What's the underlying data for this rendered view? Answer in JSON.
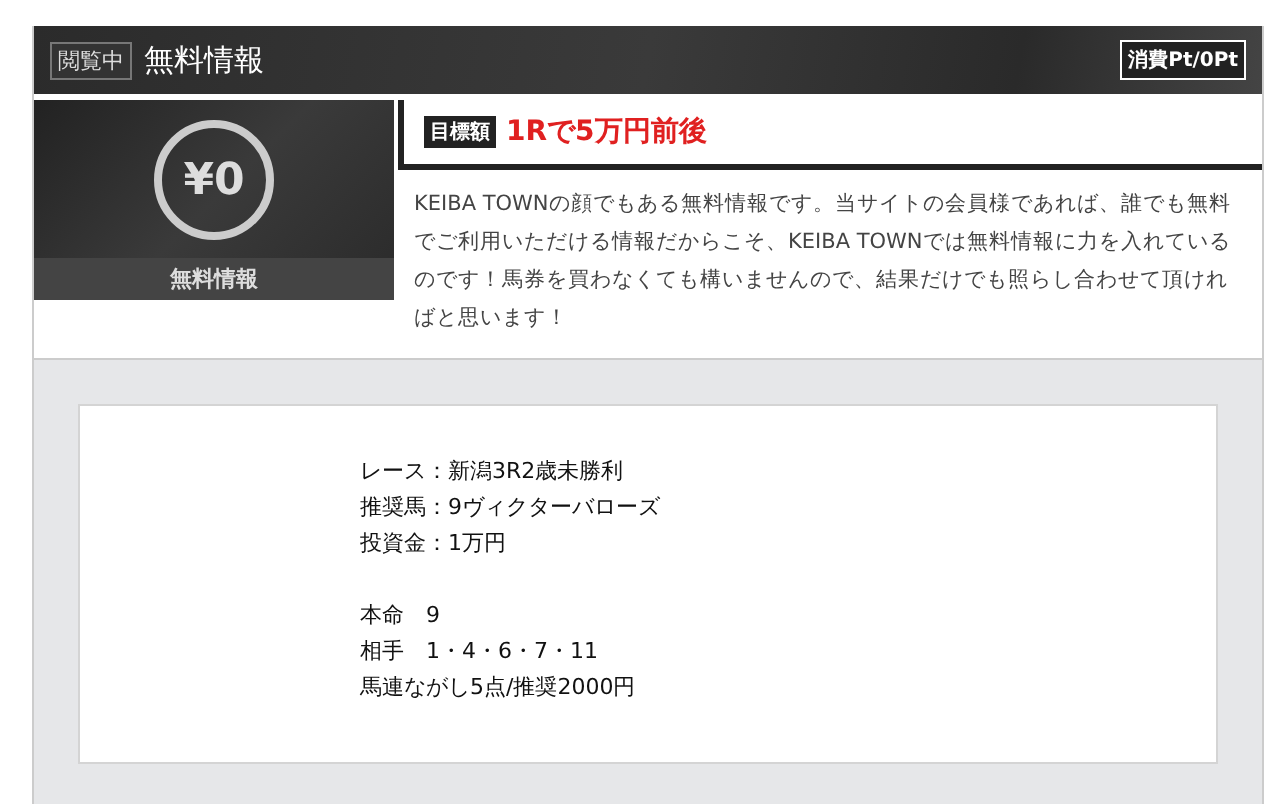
{
  "header": {
    "badge": "閲覧中",
    "title": "無料情報",
    "points": "消費Pt/0Pt"
  },
  "price_panel": {
    "amount": "¥0",
    "label": "無料情報"
  },
  "target": {
    "tag": "目標額",
    "value": "1Rで5万円前後"
  },
  "description": "KEIBA TOWNの顔でもある無料情報です。当サイトの会員様であれば、誰でも無料でご利用いただける情報だからこそ、KEIBA TOWNでは無料情報に力を入れているのです！馬券を買わなくても構いませんので、結果だけでも照らし合わせて頂ければと思います！",
  "details": [
    "レース：新潟3R2歳未勝利",
    "推奨馬：9ヴィクターバローズ",
    "投資金：1万円"
  ],
  "picks": [
    "本命　9",
    "相手　1・4・6・7・11",
    "馬連ながし5点/推奨2000円"
  ]
}
